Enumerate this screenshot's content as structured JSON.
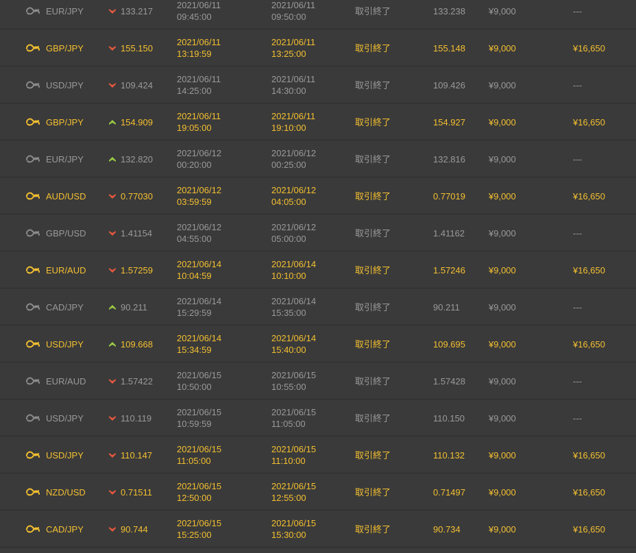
{
  "columns": {
    "status_text": "取引終了"
  },
  "colors": {
    "background": "#3a3a3a",
    "win_text": "#f4c030",
    "loss_text": "#9a9a9a",
    "arrow_down": "#e2573d",
    "arrow_up": "#9ccc45"
  },
  "rows": [
    {
      "result": "loss",
      "pair": "EUR/JPY",
      "direction": "down",
      "entry": "133.217",
      "start_date": "2021/06/11",
      "start_time": "09:45:00",
      "end_date": "2021/06/11",
      "end_time": "09:50:00",
      "status": "取引終了",
      "exit": "133.238",
      "amount": "¥9,000",
      "payout": "---"
    },
    {
      "result": "win",
      "pair": "GBP/JPY",
      "direction": "down",
      "entry": "155.150",
      "start_date": "2021/06/11",
      "start_time": "13:19:59",
      "end_date": "2021/06/11",
      "end_time": "13:25:00",
      "status": "取引終了",
      "exit": "155.148",
      "amount": "¥9,000",
      "payout": "¥16,650"
    },
    {
      "result": "loss",
      "pair": "USD/JPY",
      "direction": "down",
      "entry": "109.424",
      "start_date": "2021/06/11",
      "start_time": "14:25:00",
      "end_date": "2021/06/11",
      "end_time": "14:30:00",
      "status": "取引終了",
      "exit": "109.426",
      "amount": "¥9,000",
      "payout": "---"
    },
    {
      "result": "win",
      "pair": "GBP/JPY",
      "direction": "up",
      "entry": "154.909",
      "start_date": "2021/06/11",
      "start_time": "19:05:00",
      "end_date": "2021/06/11",
      "end_time": "19:10:00",
      "status": "取引終了",
      "exit": "154.927",
      "amount": "¥9,000",
      "payout": "¥16,650"
    },
    {
      "result": "loss",
      "pair": "EUR/JPY",
      "direction": "up",
      "entry": "132.820",
      "start_date": "2021/06/12",
      "start_time": "00:20:00",
      "end_date": "2021/06/12",
      "end_time": "00:25:00",
      "status": "取引終了",
      "exit": "132.816",
      "amount": "¥9,000",
      "payout": "---"
    },
    {
      "result": "win",
      "pair": "AUD/USD",
      "direction": "down",
      "entry": "0.77030",
      "start_date": "2021/06/12",
      "start_time": "03:59:59",
      "end_date": "2021/06/12",
      "end_time": "04:05:00",
      "status": "取引終了",
      "exit": "0.77019",
      "amount": "¥9,000",
      "payout": "¥16,650"
    },
    {
      "result": "loss",
      "pair": "GBP/USD",
      "direction": "down",
      "entry": "1.41154",
      "start_date": "2021/06/12",
      "start_time": "04:55:00",
      "end_date": "2021/06/12",
      "end_time": "05:00:00",
      "status": "取引終了",
      "exit": "1.41162",
      "amount": "¥9,000",
      "payout": "---"
    },
    {
      "result": "win",
      "pair": "EUR/AUD",
      "direction": "down",
      "entry": "1.57259",
      "start_date": "2021/06/14",
      "start_time": "10:04:59",
      "end_date": "2021/06/14",
      "end_time": "10:10:00",
      "status": "取引終了",
      "exit": "1.57246",
      "amount": "¥9,000",
      "payout": "¥16,650"
    },
    {
      "result": "loss",
      "pair": "CAD/JPY",
      "direction": "up",
      "entry": "90.211",
      "start_date": "2021/06/14",
      "start_time": "15:29:59",
      "end_date": "2021/06/14",
      "end_time": "15:35:00",
      "status": "取引終了",
      "exit": "90.211",
      "amount": "¥9,000",
      "payout": "---"
    },
    {
      "result": "win",
      "pair": "USD/JPY",
      "direction": "up",
      "entry": "109.668",
      "start_date": "2021/06/14",
      "start_time": "15:34:59",
      "end_date": "2021/06/14",
      "end_time": "15:40:00",
      "status": "取引終了",
      "exit": "109.695",
      "amount": "¥9,000",
      "payout": "¥16,650"
    },
    {
      "result": "loss",
      "pair": "EUR/AUD",
      "direction": "down",
      "entry": "1.57422",
      "start_date": "2021/06/15",
      "start_time": "10:50:00",
      "end_date": "2021/06/15",
      "end_time": "10:55:00",
      "status": "取引終了",
      "exit": "1.57428",
      "amount": "¥9,000",
      "payout": "---"
    },
    {
      "result": "loss",
      "pair": "USD/JPY",
      "direction": "down",
      "entry": "110.119",
      "start_date": "2021/06/15",
      "start_time": "10:59:59",
      "end_date": "2021/06/15",
      "end_time": "11:05:00",
      "status": "取引終了",
      "exit": "110.150",
      "amount": "¥9,000",
      "payout": "---"
    },
    {
      "result": "win",
      "pair": "USD/JPY",
      "direction": "down",
      "entry": "110.147",
      "start_date": "2021/06/15",
      "start_time": "11:05:00",
      "end_date": "2021/06/15",
      "end_time": "11:10:00",
      "status": "取引終了",
      "exit": "110.132",
      "amount": "¥9,000",
      "payout": "¥16,650"
    },
    {
      "result": "win",
      "pair": "NZD/USD",
      "direction": "down",
      "entry": "0.71511",
      "start_date": "2021/06/15",
      "start_time": "12:50:00",
      "end_date": "2021/06/15",
      "end_time": "12:55:00",
      "status": "取引終了",
      "exit": "0.71497",
      "amount": "¥9,000",
      "payout": "¥16,650"
    },
    {
      "result": "win",
      "pair": "CAD/JPY",
      "direction": "down",
      "entry": "90.744",
      "start_date": "2021/06/15",
      "start_time": "15:25:00",
      "end_date": "2021/06/15",
      "end_time": "15:30:00",
      "status": "取引終了",
      "exit": "90.734",
      "amount": "¥9,000",
      "payout": "¥16,650"
    }
  ]
}
